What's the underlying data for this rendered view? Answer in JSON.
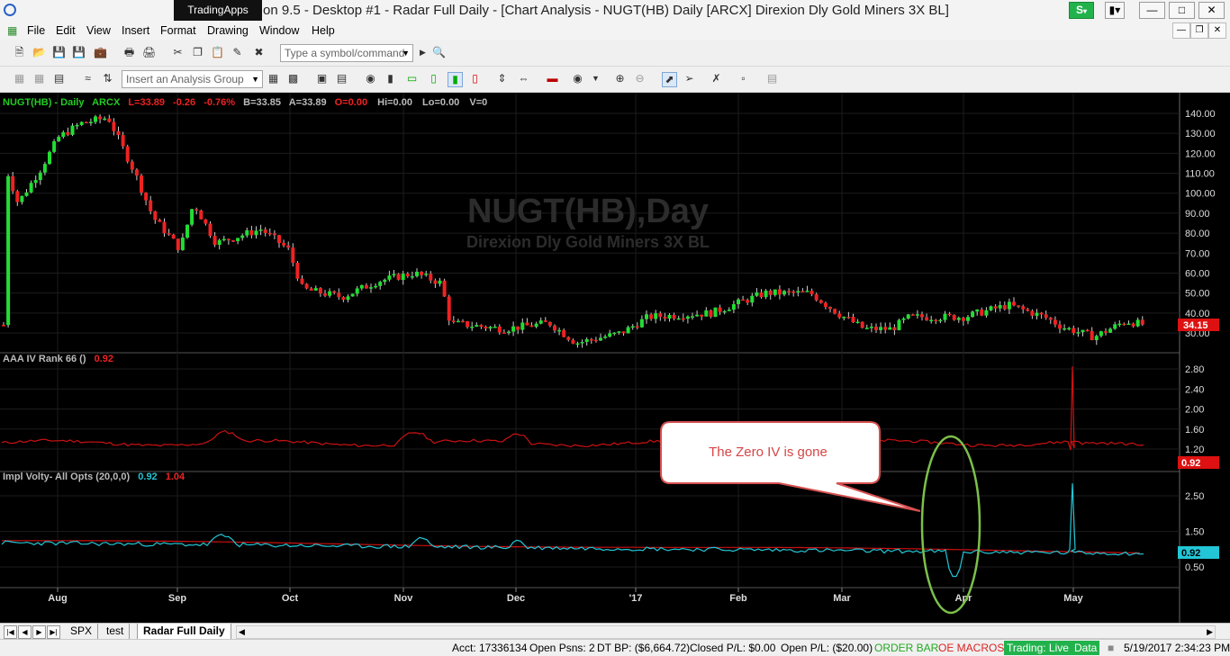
{
  "titlebar": {
    "tradingapps_label": "TradingApps",
    "title": "Station 9.5 - Desktop #1 - Radar Full Daily - [Chart Analysis - NUGT(HB) Daily [ARCX] Direxion Dly Gold Miners 3X BL]",
    "s_button": "S"
  },
  "menu": [
    "File",
    "Edit",
    "View",
    "Insert",
    "Format",
    "Drawing",
    "Window",
    "Help"
  ],
  "toolbar": {
    "symbol_placeholder": "Type a symbol/command",
    "analysis_group_placeholder": "Insert an Analysis Group"
  },
  "chart": {
    "header": {
      "symbol": "NUGT(HB) - Daily",
      "exchange": "ARCX",
      "last": "L=33.89",
      "change": "-0.26",
      "pct": "-0.76%",
      "bid": "B=33.85",
      "ask": "A=33.89",
      "open": "O=0.00",
      "hi": "Hi=0.00",
      "lo": "Lo=0.00",
      "vol": "V=0"
    },
    "watermark": {
      "title": "NUGT(HB),Day",
      "subtitle": "Direxion Dly Gold Miners 3X BL"
    },
    "price_axis": [
      "140.00",
      "130.00",
      "120.00",
      "110.00",
      "100.00",
      "90.00",
      "80.00",
      "70.00",
      "60.00",
      "50.00",
      "40.00",
      "30.00"
    ],
    "price_marker": "34.15",
    "rank_label": "AAA IV Rank 66 ()",
    "rank_value": "0.92",
    "rank_axis": [
      "2.80",
      "2.40",
      "2.00",
      "1.60",
      "1.20"
    ],
    "rank_marker": "0.92",
    "iv_label": "Impl Volty- All Opts (20,0,0)",
    "iv_value1": "0.92",
    "iv_value2": "1.04",
    "iv_axis": [
      "2.50",
      "1.50",
      "0.50"
    ],
    "iv_marker": "0.92",
    "months": [
      "Aug",
      "Sep",
      "Oct",
      "Nov",
      "Dec",
      "'17",
      "Feb",
      "Mar",
      "Apr",
      "May"
    ],
    "callout": "The Zero IV is gone",
    "colors": {
      "up": "#22dd33",
      "down": "#ee2222",
      "iv": "#22c6d6",
      "rank": "#cc1111"
    }
  },
  "tabs": [
    "SPX",
    "test",
    "Radar Full Daily"
  ],
  "status": {
    "acct": "Acct: 17336134",
    "open_psns": "Open Psns: 2",
    "dt_bp": "DT BP: ($6,664.72)",
    "closed_pl": "Closed P/L: $0.00",
    "open_pl": "Open P/L: ($20.00)",
    "order_bar": "ORDER BAR",
    "oe_macros": "OE MACROS",
    "trading": "Trading: Live",
    "data": "Data",
    "datetime": "5/19/2017 2:34:23 PM"
  }
}
